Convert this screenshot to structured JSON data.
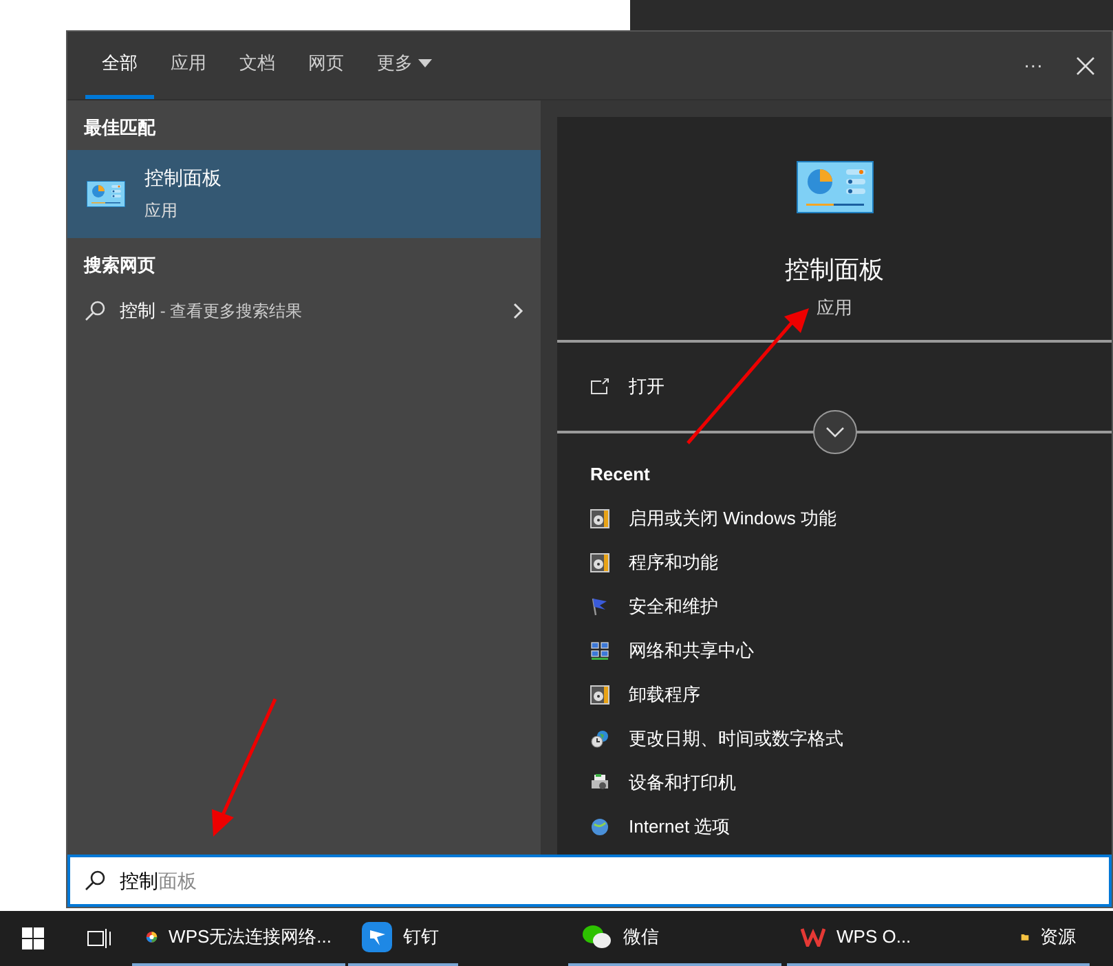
{
  "tabs": [
    {
      "label": "全部",
      "selected": true
    },
    {
      "label": "应用",
      "selected": false
    },
    {
      "label": "文档",
      "selected": false
    },
    {
      "label": "网页",
      "selected": false
    },
    {
      "label": "更多",
      "selected": false,
      "dropdown": true
    }
  ],
  "toolbar": {
    "more": "···"
  },
  "best_match": {
    "heading": "最佳匹配",
    "item": {
      "title": "控制面板",
      "subtitle": "应用",
      "selected": true
    }
  },
  "web_search": {
    "heading": "搜索网页",
    "query": "控制",
    "hint": " - 查看更多搜索结果"
  },
  "preview": {
    "title": "控制面板",
    "subtitle": "应用",
    "actions": [
      {
        "label": "打开"
      }
    ],
    "recent_heading": "Recent",
    "recent": [
      {
        "label": "启用或关闭 Windows 功能",
        "kind": "program"
      },
      {
        "label": "程序和功能",
        "kind": "program"
      },
      {
        "label": "安全和维护",
        "kind": "flag"
      },
      {
        "label": "网络和共享中心",
        "kind": "network"
      },
      {
        "label": "卸载程序",
        "kind": "program"
      },
      {
        "label": "更改日期、时间或数字格式",
        "kind": "clock"
      },
      {
        "label": "设备和打印机",
        "kind": "printer"
      },
      {
        "label": "Internet 选项",
        "kind": "globe"
      }
    ]
  },
  "search": {
    "value": "控制",
    "suggestion": "面板"
  },
  "taskbar": {
    "apps": [
      {
        "label": "WPS无法连接网络...",
        "kind": "colorwheel"
      },
      {
        "label": "钉钉",
        "kind": "ding"
      },
      {
        "label": "微信",
        "kind": "chat"
      },
      {
        "label": "WPS O...",
        "kind": "wps"
      },
      {
        "label": "资源",
        "kind": "folder"
      }
    ]
  }
}
